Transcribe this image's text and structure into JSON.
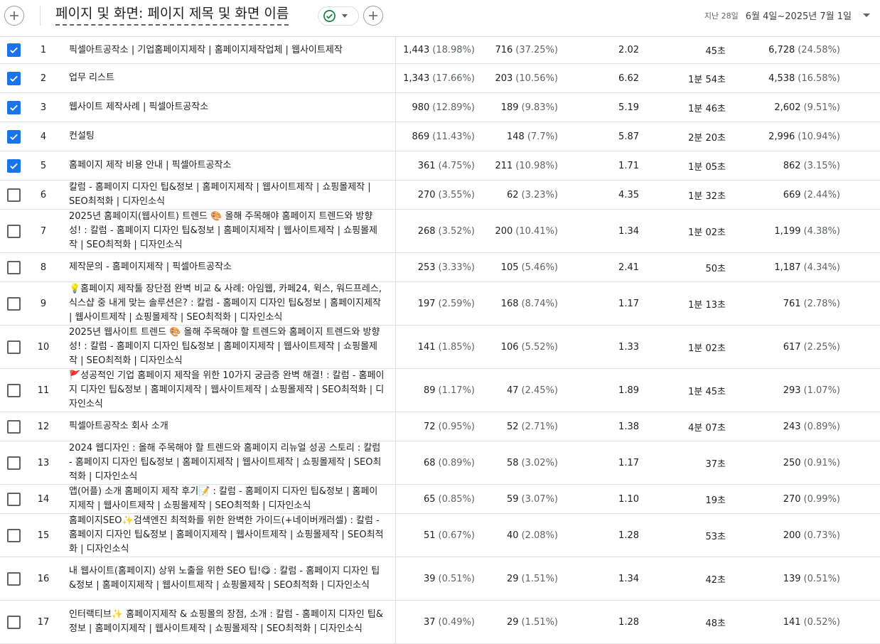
{
  "header": {
    "title": "페이지 및 화면: 페이지 제목 및 화면 이름",
    "period_label": "지난 28일",
    "period_value": "6월 4일~2025년 7월 1일",
    "accent_color": "#1a73e8",
    "status_color": "#188038",
    "icons": {
      "add": "plus-icon",
      "status": "check-circle-icon",
      "dropdown": "caret-down-icon"
    }
  },
  "rows": [
    {
      "rank": "1",
      "checked": true,
      "name": "픽셀아트공작소 | 기업홈페이지제작 | 홈페이지제작업체 | 웹사이트제작",
      "users": "1,443",
      "users_pct": "(18.98%)",
      "new_users": "716",
      "new_users_pct": "(37.25%)",
      "views_per_user": "2.02",
      "avg_time": "45초",
      "events": "6,728",
      "events_pct": "(24.58%)"
    },
    {
      "rank": "2",
      "checked": true,
      "name": "업무 리스트",
      "users": "1,343",
      "users_pct": "(17.66%)",
      "new_users": "203",
      "new_users_pct": "(10.56%)",
      "views_per_user": "6.62",
      "avg_time": "1분 54초",
      "events": "4,538",
      "events_pct": "(16.58%)"
    },
    {
      "rank": "3",
      "checked": true,
      "name": "웹사이트 제작사례 | 픽셀아트공작소",
      "users": "980",
      "users_pct": "(12.89%)",
      "new_users": "189",
      "new_users_pct": "(9.83%)",
      "views_per_user": "5.19",
      "avg_time": "1분 46초",
      "events": "2,602",
      "events_pct": "(9.51%)"
    },
    {
      "rank": "4",
      "checked": true,
      "name": "컨설팅",
      "users": "869",
      "users_pct": "(11.43%)",
      "new_users": "148",
      "new_users_pct": "(7.7%)",
      "views_per_user": "5.87",
      "avg_time": "2분 20초",
      "events": "2,996",
      "events_pct": "(10.94%)"
    },
    {
      "rank": "5",
      "checked": true,
      "name": "홈페이지 제작 비용 안내 | 픽셀아트공작소",
      "users": "361",
      "users_pct": "(4.75%)",
      "new_users": "211",
      "new_users_pct": "(10.98%)",
      "views_per_user": "1.71",
      "avg_time": "1분 05초",
      "events": "862",
      "events_pct": "(3.15%)"
    },
    {
      "rank": "6",
      "checked": false,
      "name": "칼럼 - 홈페이지 디자인 팁&정보 | 홈페이지제작 | 웹사이트제작 | 쇼핑몰제작 | SEO최적화 | 디자인소식",
      "users": "270",
      "users_pct": "(3.55%)",
      "new_users": "62",
      "new_users_pct": "(3.23%)",
      "views_per_user": "4.35",
      "avg_time": "1분 32초",
      "events": "669",
      "events_pct": "(2.44%)"
    },
    {
      "rank": "7",
      "checked": false,
      "name": "2025년 홈페이지(웹사이트) 트렌드 🎨 올해 주목해야 홈페이지 트렌드와 방향성! : 칼럼 - 홈페이지 디자인 팁&정보 | 홈페이지제작 | 웹사이트제작 | 쇼핑몰제작 | SEO최적화 | 디자인소식",
      "users": "268",
      "users_pct": "(3.52%)",
      "new_users": "200",
      "new_users_pct": "(10.41%)",
      "views_per_user": "1.34",
      "avg_time": "1분 02초",
      "events": "1,199",
      "events_pct": "(4.38%)"
    },
    {
      "rank": "8",
      "checked": false,
      "name": "제작문의 - 홈페이지제작 | 픽셀아트공작소",
      "users": "253",
      "users_pct": "(3.33%)",
      "new_users": "105",
      "new_users_pct": "(5.46%)",
      "views_per_user": "2.41",
      "avg_time": "50초",
      "events": "1,187",
      "events_pct": "(4.34%)"
    },
    {
      "rank": "9",
      "checked": false,
      "name": "💡홈페이지 제작툴 장단점 완벽 비교 & 사례: 아임웹, 카페24, 윅스, 워드프레스, 식스샵 중 내게 맞는 솔루션은? : 칼럼 - 홈페이지 디자인 팁&정보 | 홈페이지제작 | 웹사이트제작 | 쇼핑몰제작 | SEO최적화 | 디자인소식",
      "users": "197",
      "users_pct": "(2.59%)",
      "new_users": "168",
      "new_users_pct": "(8.74%)",
      "views_per_user": "1.17",
      "avg_time": "1분 13초",
      "events": "761",
      "events_pct": "(2.78%)"
    },
    {
      "rank": "10",
      "checked": false,
      "name": "2025년 웹사이트 트렌드 🎨 올해 주목해야 할 트렌드와 홈페이지 트렌드와 방향성! : 칼럼 - 홈페이지 디자인 팁&정보 | 홈페이지제작 | 웹사이트제작 | 쇼핑몰제작 | SEO최적화 | 디자인소식",
      "users": "141",
      "users_pct": "(1.85%)",
      "new_users": "106",
      "new_users_pct": "(5.52%)",
      "views_per_user": "1.33",
      "avg_time": "1분 02초",
      "events": "617",
      "events_pct": "(2.25%)"
    },
    {
      "rank": "11",
      "checked": false,
      "name": "🚩성공적인 기업 홈페이지 제작을 위한 10가지 궁금증 완벽 해결! : 칼럼 - 홈페이지 디자인 팁&정보 | 홈페이지제작 | 웹사이트제작 | 쇼핑몰제작 | SEO최적화 | 디자인소식",
      "users": "89",
      "users_pct": "(1.17%)",
      "new_users": "47",
      "new_users_pct": "(2.45%)",
      "views_per_user": "1.89",
      "avg_time": "1분 45초",
      "events": "293",
      "events_pct": "(1.07%)"
    },
    {
      "rank": "12",
      "checked": false,
      "name": "픽셀아트공작소 회사 소개",
      "users": "72",
      "users_pct": "(0.95%)",
      "new_users": "52",
      "new_users_pct": "(2.71%)",
      "views_per_user": "1.38",
      "avg_time": "4분 07초",
      "events": "243",
      "events_pct": "(0.89%)"
    },
    {
      "rank": "13",
      "checked": false,
      "name": "2024 웹디자인 : 올해 주목해야 할 트렌드와 홈페이지 리뉴얼 성공 스토리 : 칼럼 - 홈페이지 디자인 팁&정보 | 홈페이지제작 | 웹사이트제작 | 쇼핑몰제작 | SEO최적화 | 디자인소식",
      "users": "68",
      "users_pct": "(0.89%)",
      "new_users": "58",
      "new_users_pct": "(3.02%)",
      "views_per_user": "1.17",
      "avg_time": "37초",
      "events": "250",
      "events_pct": "(0.91%)"
    },
    {
      "rank": "14",
      "checked": false,
      "name": "앱(어플) 소개 홈페이지 제작 후기📝 : 칼럼 - 홈페이지 디자인 팁&정보 | 홈페이지제작 | 웹사이트제작 | 쇼핑몰제작 | SEO최적화 | 디자인소식",
      "users": "65",
      "users_pct": "(0.85%)",
      "new_users": "59",
      "new_users_pct": "(3.07%)",
      "views_per_user": "1.10",
      "avg_time": "19초",
      "events": "270",
      "events_pct": "(0.99%)"
    },
    {
      "rank": "15",
      "checked": false,
      "name": "홈페이지SEO✨검색엔진 최적화를 위한 완벽한 가이드(+네이버캐러셀) : 칼럼 - 홈페이지 디자인 팁&정보 | 홈페이지제작 | 웹사이트제작 | 쇼핑몰제작 | SEO최적화 | 디자인소식",
      "users": "51",
      "users_pct": "(0.67%)",
      "new_users": "40",
      "new_users_pct": "(2.08%)",
      "views_per_user": "1.28",
      "avg_time": "53초",
      "events": "200",
      "events_pct": "(0.73%)"
    },
    {
      "rank": "16",
      "checked": false,
      "name": "내 웹사이트(홈페이지) 상위 노출을 위한 SEO 팁!😋 : 칼럼 - 홈페이지 디자인 팁&정보 | 홈페이지제작 | 웹사이트제작 | 쇼핑몰제작 | SEO최적화 | 디자인소식",
      "users": "39",
      "users_pct": "(0.51%)",
      "new_users": "29",
      "new_users_pct": "(1.51%)",
      "views_per_user": "1.34",
      "avg_time": "42초",
      "events": "139",
      "events_pct": "(0.51%)"
    },
    {
      "rank": "17",
      "checked": false,
      "name": "인터랙티브✨ 홈페이지제작 & 쇼핑몰의 장점, 소개 : 칼럼 - 홈페이지 디자인 팁&정보 | 홈페이지제작 | 웹사이트제작 | 쇼핑몰제작 | SEO최적화 | 디자인소식",
      "users": "37",
      "users_pct": "(0.49%)",
      "new_users": "29",
      "new_users_pct": "(1.51%)",
      "views_per_user": "1.28",
      "avg_time": "48초",
      "events": "141",
      "events_pct": "(0.52%)"
    }
  ]
}
